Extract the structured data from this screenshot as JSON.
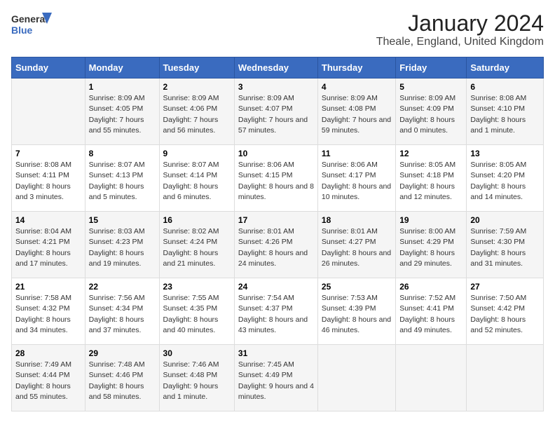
{
  "header": {
    "logo_line1": "General",
    "logo_line2": "Blue",
    "main_title": "January 2024",
    "subtitle": "Theale, England, United Kingdom"
  },
  "days_of_week": [
    "Sunday",
    "Monday",
    "Tuesday",
    "Wednesday",
    "Thursday",
    "Friday",
    "Saturday"
  ],
  "weeks": [
    [
      {
        "day": "",
        "sunrise": "",
        "sunset": "",
        "daylight": ""
      },
      {
        "day": "1",
        "sunrise": "Sunrise: 8:09 AM",
        "sunset": "Sunset: 4:05 PM",
        "daylight": "Daylight: 7 hours and 55 minutes."
      },
      {
        "day": "2",
        "sunrise": "Sunrise: 8:09 AM",
        "sunset": "Sunset: 4:06 PM",
        "daylight": "Daylight: 7 hours and 56 minutes."
      },
      {
        "day": "3",
        "sunrise": "Sunrise: 8:09 AM",
        "sunset": "Sunset: 4:07 PM",
        "daylight": "Daylight: 7 hours and 57 minutes."
      },
      {
        "day": "4",
        "sunrise": "Sunrise: 8:09 AM",
        "sunset": "Sunset: 4:08 PM",
        "daylight": "Daylight: 7 hours and 59 minutes."
      },
      {
        "day": "5",
        "sunrise": "Sunrise: 8:09 AM",
        "sunset": "Sunset: 4:09 PM",
        "daylight": "Daylight: 8 hours and 0 minutes."
      },
      {
        "day": "6",
        "sunrise": "Sunrise: 8:08 AM",
        "sunset": "Sunset: 4:10 PM",
        "daylight": "Daylight: 8 hours and 1 minute."
      }
    ],
    [
      {
        "day": "7",
        "sunrise": "Sunrise: 8:08 AM",
        "sunset": "Sunset: 4:11 PM",
        "daylight": "Daylight: 8 hours and 3 minutes."
      },
      {
        "day": "8",
        "sunrise": "Sunrise: 8:07 AM",
        "sunset": "Sunset: 4:13 PM",
        "daylight": "Daylight: 8 hours and 5 minutes."
      },
      {
        "day": "9",
        "sunrise": "Sunrise: 8:07 AM",
        "sunset": "Sunset: 4:14 PM",
        "daylight": "Daylight: 8 hours and 6 minutes."
      },
      {
        "day": "10",
        "sunrise": "Sunrise: 8:06 AM",
        "sunset": "Sunset: 4:15 PM",
        "daylight": "Daylight: 8 hours and 8 minutes."
      },
      {
        "day": "11",
        "sunrise": "Sunrise: 8:06 AM",
        "sunset": "Sunset: 4:17 PM",
        "daylight": "Daylight: 8 hours and 10 minutes."
      },
      {
        "day": "12",
        "sunrise": "Sunrise: 8:05 AM",
        "sunset": "Sunset: 4:18 PM",
        "daylight": "Daylight: 8 hours and 12 minutes."
      },
      {
        "day": "13",
        "sunrise": "Sunrise: 8:05 AM",
        "sunset": "Sunset: 4:20 PM",
        "daylight": "Daylight: 8 hours and 14 minutes."
      }
    ],
    [
      {
        "day": "14",
        "sunrise": "Sunrise: 8:04 AM",
        "sunset": "Sunset: 4:21 PM",
        "daylight": "Daylight: 8 hours and 17 minutes."
      },
      {
        "day": "15",
        "sunrise": "Sunrise: 8:03 AM",
        "sunset": "Sunset: 4:23 PM",
        "daylight": "Daylight: 8 hours and 19 minutes."
      },
      {
        "day": "16",
        "sunrise": "Sunrise: 8:02 AM",
        "sunset": "Sunset: 4:24 PM",
        "daylight": "Daylight: 8 hours and 21 minutes."
      },
      {
        "day": "17",
        "sunrise": "Sunrise: 8:01 AM",
        "sunset": "Sunset: 4:26 PM",
        "daylight": "Daylight: 8 hours and 24 minutes."
      },
      {
        "day": "18",
        "sunrise": "Sunrise: 8:01 AM",
        "sunset": "Sunset: 4:27 PM",
        "daylight": "Daylight: 8 hours and 26 minutes."
      },
      {
        "day": "19",
        "sunrise": "Sunrise: 8:00 AM",
        "sunset": "Sunset: 4:29 PM",
        "daylight": "Daylight: 8 hours and 29 minutes."
      },
      {
        "day": "20",
        "sunrise": "Sunrise: 7:59 AM",
        "sunset": "Sunset: 4:30 PM",
        "daylight": "Daylight: 8 hours and 31 minutes."
      }
    ],
    [
      {
        "day": "21",
        "sunrise": "Sunrise: 7:58 AM",
        "sunset": "Sunset: 4:32 PM",
        "daylight": "Daylight: 8 hours and 34 minutes."
      },
      {
        "day": "22",
        "sunrise": "Sunrise: 7:56 AM",
        "sunset": "Sunset: 4:34 PM",
        "daylight": "Daylight: 8 hours and 37 minutes."
      },
      {
        "day": "23",
        "sunrise": "Sunrise: 7:55 AM",
        "sunset": "Sunset: 4:35 PM",
        "daylight": "Daylight: 8 hours and 40 minutes."
      },
      {
        "day": "24",
        "sunrise": "Sunrise: 7:54 AM",
        "sunset": "Sunset: 4:37 PM",
        "daylight": "Daylight: 8 hours and 43 minutes."
      },
      {
        "day": "25",
        "sunrise": "Sunrise: 7:53 AM",
        "sunset": "Sunset: 4:39 PM",
        "daylight": "Daylight: 8 hours and 46 minutes."
      },
      {
        "day": "26",
        "sunrise": "Sunrise: 7:52 AM",
        "sunset": "Sunset: 4:41 PM",
        "daylight": "Daylight: 8 hours and 49 minutes."
      },
      {
        "day": "27",
        "sunrise": "Sunrise: 7:50 AM",
        "sunset": "Sunset: 4:42 PM",
        "daylight": "Daylight: 8 hours and 52 minutes."
      }
    ],
    [
      {
        "day": "28",
        "sunrise": "Sunrise: 7:49 AM",
        "sunset": "Sunset: 4:44 PM",
        "daylight": "Daylight: 8 hours and 55 minutes."
      },
      {
        "day": "29",
        "sunrise": "Sunrise: 7:48 AM",
        "sunset": "Sunset: 4:46 PM",
        "daylight": "Daylight: 8 hours and 58 minutes."
      },
      {
        "day": "30",
        "sunrise": "Sunrise: 7:46 AM",
        "sunset": "Sunset: 4:48 PM",
        "daylight": "Daylight: 9 hours and 1 minute."
      },
      {
        "day": "31",
        "sunrise": "Sunrise: 7:45 AM",
        "sunset": "Sunset: 4:49 PM",
        "daylight": "Daylight: 9 hours and 4 minutes."
      },
      {
        "day": "",
        "sunrise": "",
        "sunset": "",
        "daylight": ""
      },
      {
        "day": "",
        "sunrise": "",
        "sunset": "",
        "daylight": ""
      },
      {
        "day": "",
        "sunrise": "",
        "sunset": "",
        "daylight": ""
      }
    ]
  ]
}
